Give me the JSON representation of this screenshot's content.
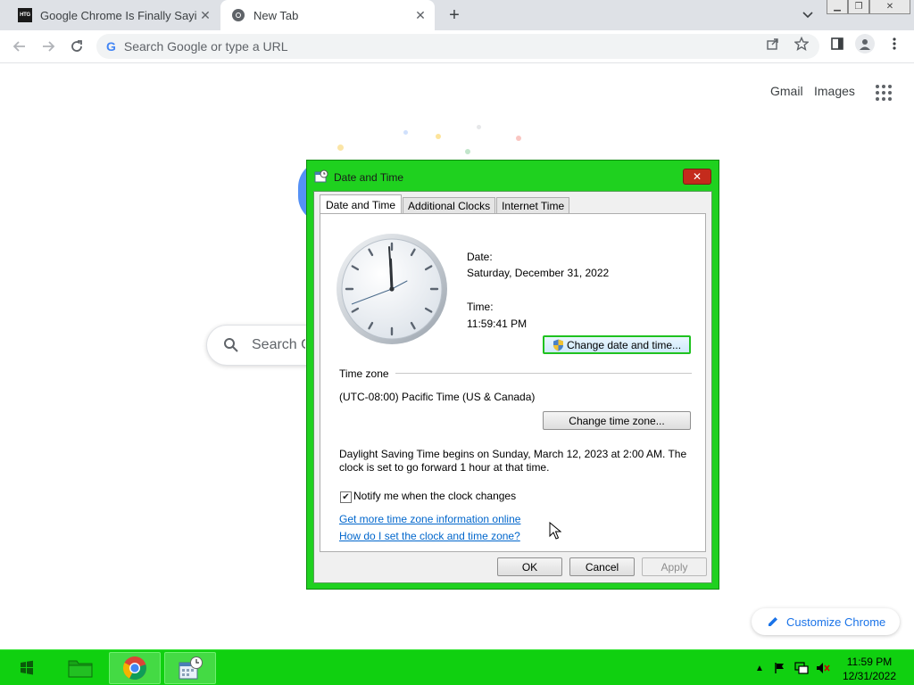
{
  "browser": {
    "tabs": [
      {
        "title": "Google Chrome Is Finally Saying",
        "favicon": "htg-icon",
        "favicon_text": "HTG",
        "active": false
      },
      {
        "title": "New Tab",
        "favicon": "chrome-icon",
        "active": true
      }
    ],
    "omnibox_placeholder": "Search Google or type a URL"
  },
  "ntp": {
    "gmail_label": "Gmail",
    "images_label": "Images",
    "search_placeholder": "Search G",
    "customize_label": "Customize Chrome"
  },
  "dialog": {
    "title": "Date and Time",
    "tabs": [
      "Date and Time",
      "Additional Clocks",
      "Internet Time"
    ],
    "date_label": "Date:",
    "date_value": "Saturday, December 31, 2022",
    "time_label": "Time:",
    "time_value": "11:59:41 PM",
    "change_datetime_button": "Change date and time...",
    "timezone_heading": "Time zone",
    "timezone_value": "(UTC-08:00) Pacific Time (US & Canada)",
    "change_timezone_button": "Change time zone...",
    "dst_line1": "Daylight Saving Time begins on Sunday, March 12, 2023 at 2:00 AM. The",
    "dst_line2": "clock is set to go forward 1 hour at that time.",
    "notify_label": "Notify me when the clock changes",
    "notify_checked": true,
    "link_more_info": "Get more time zone information online",
    "link_how_to": "How do I set the clock and time zone?",
    "ok_button": "OK",
    "cancel_button": "Cancel",
    "apply_button": "Apply"
  },
  "taskbar": {
    "time": "11:59 PM",
    "date": "12/31/2022",
    "accent_color": "#10d010"
  }
}
